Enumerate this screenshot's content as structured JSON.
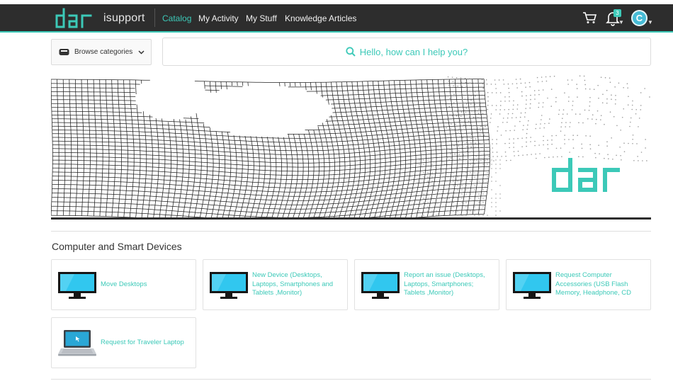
{
  "header": {
    "logo_text": "dar",
    "brand": "isupport",
    "nav": [
      {
        "label": "Catalog",
        "active": true
      },
      {
        "label": "My Activity",
        "active": false
      },
      {
        "label": "My Stuff",
        "active": false
      },
      {
        "label": "Knowledge Articles",
        "active": false
      }
    ],
    "cart_icon": "cart-icon",
    "notifications_icon": "bell-icon",
    "notification_count": "3",
    "avatar_initial": "C",
    "accent_color": "#3cc9b8",
    "navbar_color": "#2d2d2d"
  },
  "search": {
    "browse_label": "Browse categories",
    "placeholder": "Hello, how can I help you?"
  },
  "hero": {
    "logo_text": "dar"
  },
  "section": {
    "title": "Computer and Smart Devices",
    "items": [
      {
        "label": "Move Desktops",
        "icon": "monitor-icon"
      },
      {
        "label": "New Device (Desktops, Laptops, Smartphones and Tablets ,Monitor)",
        "icon": "monitor-icon"
      },
      {
        "label": "Report an issue (Desktops, Laptops, Smartphones; Tablets ,Monitor)",
        "icon": "monitor-icon"
      },
      {
        "label": "Request Computer Accessories (USB Flash Memory, Headphone, CD",
        "icon": "monitor-icon"
      },
      {
        "label": "Request for Traveler Laptop",
        "icon": "laptop-icon"
      }
    ]
  }
}
